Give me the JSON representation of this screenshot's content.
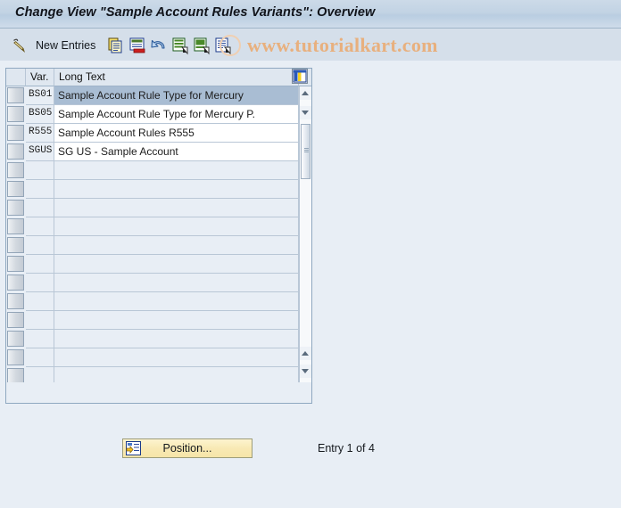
{
  "window": {
    "title": "Change View \"Sample Account Rules Variants\": Overview"
  },
  "toolbar": {
    "edit_icon": "pencil-icon",
    "new_entries_label": "New Entries",
    "buttons": [
      {
        "icon": "copy-icon"
      },
      {
        "icon": "delete-icon"
      },
      {
        "icon": "undo-icon"
      },
      {
        "icon": "select-all-icon"
      },
      {
        "icon": "deselect-all-icon"
      },
      {
        "icon": "details-icon"
      }
    ],
    "watermark": "www.tutorialkart.com"
  },
  "table": {
    "settings_icon": "table-settings-icon",
    "columns": [
      {
        "key": "var",
        "label": "Var."
      },
      {
        "key": "long_text",
        "label": "Long Text"
      }
    ],
    "rows": [
      {
        "var": "BS01",
        "long_text": "Sample Account Rule Type for Mercury",
        "selected": true
      },
      {
        "var": "BS05",
        "long_text": "Sample Account Rule Type for Mercury P.",
        "selected": false
      },
      {
        "var": "R555",
        "long_text": "Sample Account Rules R555",
        "selected": false
      },
      {
        "var": "SGUS",
        "long_text": "SG US - Sample Account",
        "selected": false
      }
    ],
    "empty_row_count": 12,
    "vertical_scrollbar": {
      "up_icon": "scroll-up-icon",
      "down_icon": "scroll-down-icon",
      "bottom_up_icon": "scroll-page-up-icon",
      "bottom_down_icon": "scroll-page-down-icon",
      "thumb_grip_icon": "scroll-thumb-grip-icon"
    },
    "horizontal_scrollbar": {
      "left_icon": "scroll-left-icon",
      "right_icon": "scroll-right-icon",
      "far_left_icon": "scroll-far-left-icon",
      "far_right_icon": "scroll-far-right-icon"
    }
  },
  "footer": {
    "position_button_label": "Position...",
    "position_button_icon": "position-icon",
    "entry_status": "Entry 1 of 4"
  },
  "colors": {
    "titlebar": "#c2d3e4",
    "toolbar": "#d5dfea",
    "body": "#e8eef5",
    "selection": "#a9bdd3",
    "panel_border": "#8fa8c0",
    "watermark": "#e8b07e",
    "button_yellow": "#f8e9b4"
  }
}
